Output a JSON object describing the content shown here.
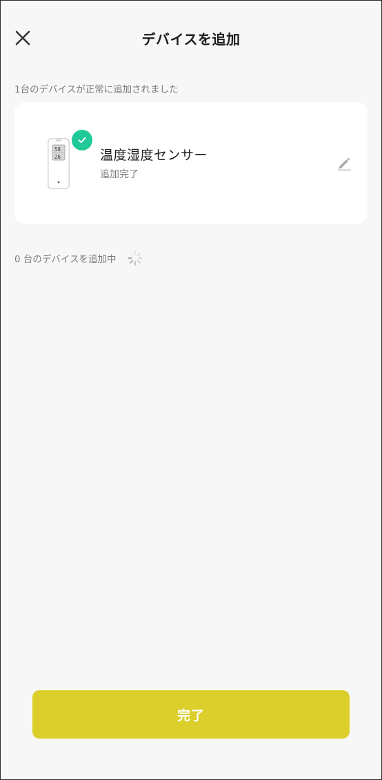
{
  "header": {
    "title": "デバイスを追加",
    "close_icon": "close-icon"
  },
  "success_section": {
    "label": "1台のデバイスが正常に追加されました",
    "devices": [
      {
        "name": "温度湿度センサー",
        "status": "追加完了",
        "image": "thermo-hygrometer-device-image",
        "display_readings": [
          "58",
          "26"
        ],
        "badge_icon": "check-icon",
        "edit_icon": "pencil-icon"
      }
    ]
  },
  "pending_section": {
    "label": "0 台のデバイスを追加中",
    "indicator_icon": "loading-spinner-icon"
  },
  "footer": {
    "done_label": "完了"
  },
  "colors": {
    "background": "#f7f7f7",
    "card": "#ffffff",
    "success_badge": "#20c997",
    "primary_button": "#dccf2b"
  }
}
